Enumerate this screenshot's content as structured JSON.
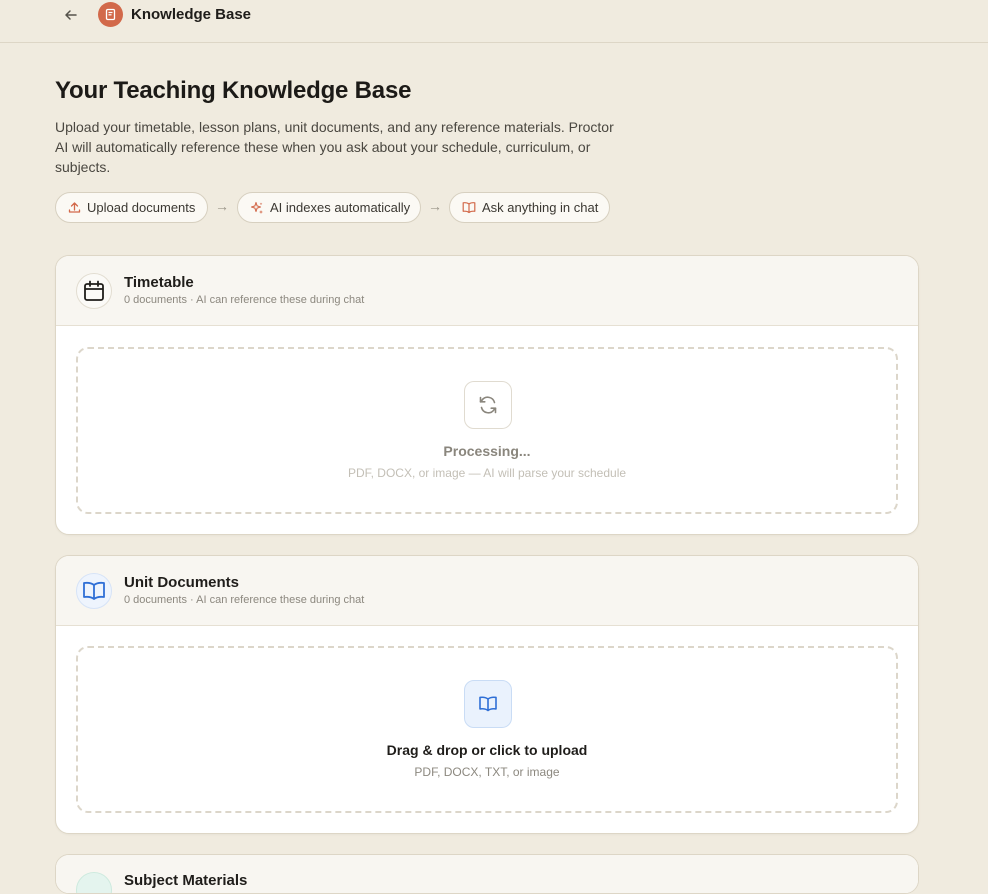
{
  "header": {
    "title": "Knowledge Base",
    "back_icon": "arrow-left-icon",
    "logo_icon": "book-icon"
  },
  "hero": {
    "title": "Your Teaching Knowledge Base",
    "description": "Upload your timetable, lesson plans, unit documents, and any reference materials. Proctor AI will automatically reference these when you ask about your schedule, curriculum, or subjects."
  },
  "steps": [
    {
      "label": "Upload documents",
      "icon": "upload-icon"
    },
    {
      "label": "AI indexes automatically",
      "icon": "sparkles-icon"
    },
    {
      "label": "Ask anything in chat",
      "icon": "book-open-icon"
    }
  ],
  "step_arrow": "→",
  "sections": [
    {
      "title": "Timetable",
      "subtitle": "0 documents · AI can reference these during chat",
      "icon": "calendar-icon",
      "dropzone": {
        "title": "Processing...",
        "hint": "PDF, DOCX, or image — AI will parse your schedule",
        "icon": "refresh-icon"
      }
    },
    {
      "title": "Unit Documents",
      "subtitle": "0 documents · AI can reference these during chat",
      "icon": "book-open-icon",
      "dropzone": {
        "title": "Drag & drop or click to upload",
        "hint": "PDF, DOCX, TXT, or image",
        "icon": "book-open-icon"
      }
    },
    {
      "title": "Subject Materials",
      "icon": "layers-icon"
    }
  ],
  "colors": {
    "background": "#f0ebdf",
    "accent": "#d2694a",
    "blue": "#2f6fd6"
  }
}
